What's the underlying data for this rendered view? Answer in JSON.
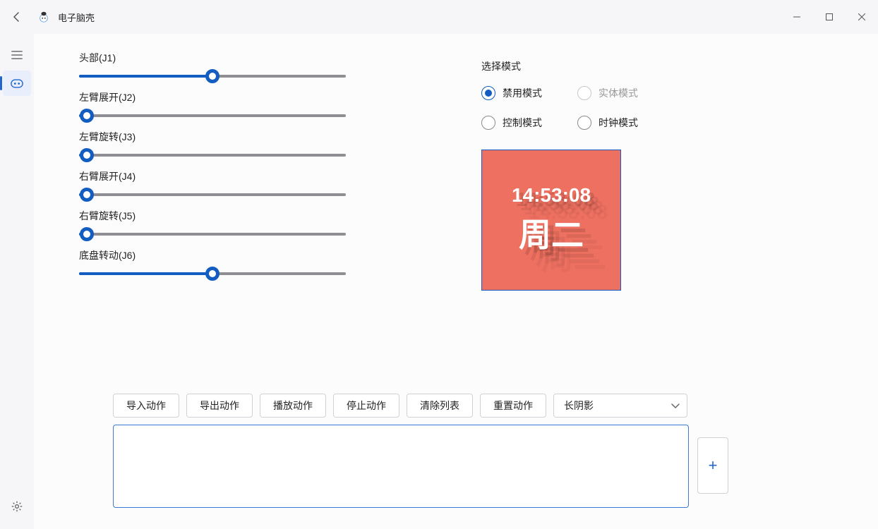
{
  "app": {
    "title": "电子脑壳"
  },
  "sliders": [
    {
      "label": "头部(J1)",
      "percent": 50
    },
    {
      "label": "左臂展开(J2)",
      "percent": 3
    },
    {
      "label": "左臂旋转(J3)",
      "percent": 3
    },
    {
      "label": "右臂展开(J4)",
      "percent": 3
    },
    {
      "label": "右臂旋转(J5)",
      "percent": 3
    },
    {
      "label": "底盘转动(J6)",
      "percent": 50
    }
  ],
  "mode": {
    "title": "选择模式",
    "options": [
      {
        "label": "禁用模式",
        "selected": true,
        "disabled": false
      },
      {
        "label": "实体模式",
        "selected": false,
        "disabled": true
      },
      {
        "label": "控制模式",
        "selected": false,
        "disabled": false
      },
      {
        "label": "时钟模式",
        "selected": false,
        "disabled": false
      }
    ]
  },
  "clock": {
    "time": "14:53:08",
    "weekday": "周二"
  },
  "actions": {
    "import": "导入动作",
    "export": "导出动作",
    "play": "播放动作",
    "stop": "停止动作",
    "clear": "清除列表",
    "reset": "重置动作"
  },
  "effect_select": {
    "value": "长阴影"
  },
  "add_button": "+"
}
